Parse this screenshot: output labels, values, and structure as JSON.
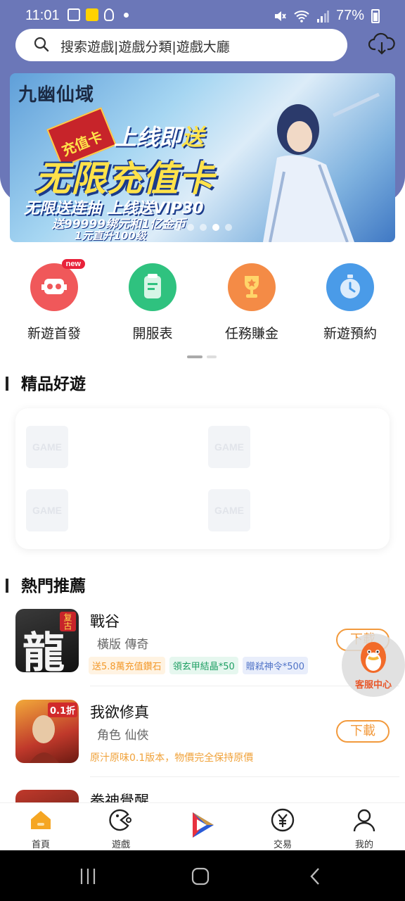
{
  "status_bar": {
    "time": "11:01",
    "battery": "77%"
  },
  "search": {
    "placeholder": "搜索遊戲|遊戲分類|遊戲大廳"
  },
  "banner": {
    "logo": "九幽仙域",
    "tag": "充值卡",
    "line1_prefix": "上线即",
    "line1_highlight": "送",
    "title": "无限充值卡",
    "line3": "无限送连抽 上线送VIP30",
    "line4": "送99999绑元和1亿金币",
    "line5": "1元直升100级",
    "slide_count": 5,
    "active_slide": 4
  },
  "quick_actions": [
    {
      "label": "新遊首發",
      "badge": "new",
      "color": "#f0585a",
      "icon": "robot-icon"
    },
    {
      "label": "開服表",
      "badge": "",
      "color": "#2fc27f",
      "icon": "clipboard-icon"
    },
    {
      "label": "任務賺金",
      "badge": "",
      "color": "#f48b46",
      "icon": "trophy-icon"
    },
    {
      "label": "新遊預約",
      "badge": "",
      "color": "#4a9be8",
      "icon": "stopwatch-icon"
    }
  ],
  "sections": {
    "featured": "精品好遊",
    "hot": "熱門推薦"
  },
  "placeholder_logo": "GAME",
  "games": [
    {
      "name": "戰谷",
      "subtitle": "橫版 傳奇",
      "tags": [
        "送5.8萬充值鑽石",
        "領玄甲結晶*50",
        "贈弒神令*500"
      ],
      "desc": "",
      "button": "下載",
      "icon_char": "龍",
      "icon_corner": "复古"
    },
    {
      "name": "我欲修真",
      "subtitle": "角色 仙俠",
      "tags": [],
      "desc": "原汁原味0.1版本，物價完全保持原價",
      "button": "下載",
      "icon_char": "",
      "icon_corner": "0.1折"
    },
    {
      "name": "拳神覺醒",
      "subtitle": "",
      "tags": [],
      "desc": "",
      "button": "",
      "icon_char": "",
      "icon_corner": ""
    }
  ],
  "floating_cs": {
    "label": "客服中心"
  },
  "bottom_nav": [
    {
      "label": "首頁",
      "icon": "home-icon",
      "active": true
    },
    {
      "label": "遊戲",
      "icon": "gamepad-icon",
      "active": false
    },
    {
      "label": "",
      "icon": "play-logo-icon",
      "active": false
    },
    {
      "label": "交易",
      "icon": "yen-icon",
      "active": false
    },
    {
      "label": "我的",
      "icon": "user-icon",
      "active": false
    }
  ],
  "colors": {
    "header": "#6b77b8",
    "accent_orange": "#f29a3d",
    "home_active": "#f5a623"
  }
}
